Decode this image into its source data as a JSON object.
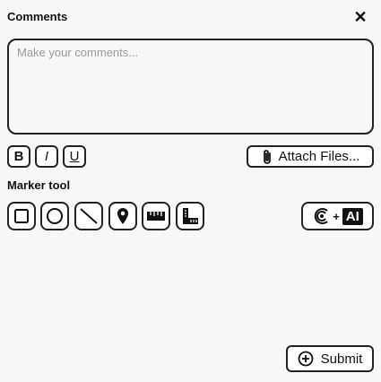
{
  "panel": {
    "title": "Comments",
    "close_symbol": "✕"
  },
  "comments_input": {
    "placeholder": "Make your comments...",
    "value": ""
  },
  "formatting": {
    "bold_label": "B",
    "italic_label": "I",
    "underline_label": "U"
  },
  "attach": {
    "label": "Attach Files...",
    "icon": "paperclip-icon"
  },
  "marker_tool": {
    "label": "Marker tool",
    "tools": [
      "rectangle-icon",
      "circle-icon",
      "line-icon",
      "location-pin-icon",
      "ruler-icon",
      "angle-ruler-icon"
    ]
  },
  "ai_button": {
    "plus": "+",
    "badge": "AI",
    "icon": "curve-logo-icon"
  },
  "submit": {
    "label": "Submit",
    "icon": "plus-circle-icon"
  }
}
